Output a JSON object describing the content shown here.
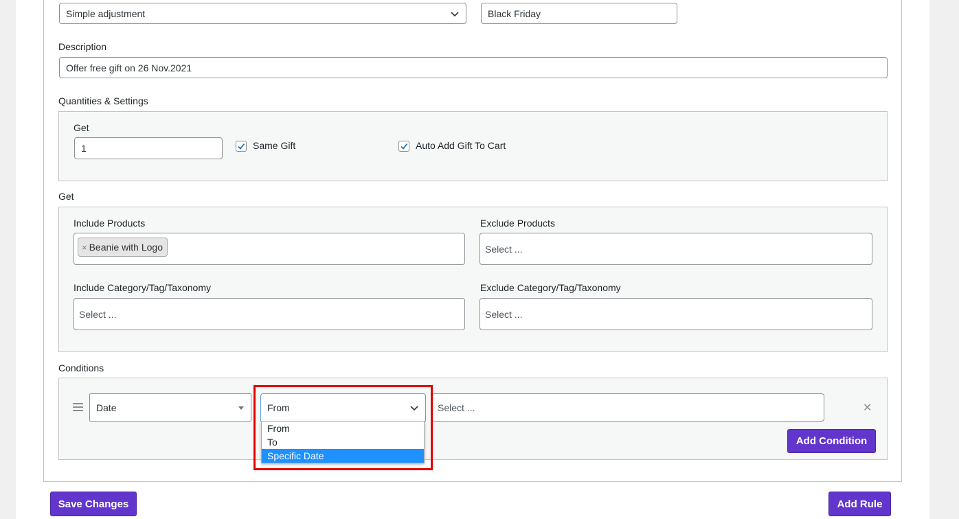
{
  "top_row": {
    "adjustment_select": "Simple adjustment",
    "rule_title_value": "Black Friday"
  },
  "description": {
    "label": "Description",
    "value": "Offer free gift on 26 Nov.2021"
  },
  "quantities": {
    "label": "Quantities & Settings",
    "get_label": "Get",
    "get_value": "1",
    "same_gift_label": "Same Gift",
    "same_gift_checked": true,
    "auto_add_label": "Auto Add Gift To Cart",
    "auto_add_checked": true
  },
  "get_section": {
    "label": "Get",
    "include_products_label": "Include Products",
    "include_products_chips": [
      "Beanie with Logo"
    ],
    "chip_remove": "×",
    "exclude_products_label": "Exclude Products",
    "exclude_products_placeholder": "Select ...",
    "include_category_label": "Include Category/Tag/Taxonomy",
    "include_category_placeholder": "Select ...",
    "exclude_category_label": "Exclude Category/Tag/Taxonomy",
    "exclude_category_placeholder": "Select ..."
  },
  "conditions": {
    "label": "Conditions",
    "type_select": "Date",
    "operator_select": "From",
    "value_placeholder": "Select ...",
    "remove_symbol": "✕",
    "add_condition_label": "Add Condition",
    "operator_options": [
      "From",
      "To",
      "Specific Date"
    ],
    "operator_highlighted": "Specific Date"
  },
  "footer": {
    "save_label": "Save Changes",
    "add_rule_label": "Add Rule"
  },
  "colors": {
    "accent": "#6236cc",
    "highlight_border": "#e20000",
    "option_selected": "#1e90ff"
  }
}
